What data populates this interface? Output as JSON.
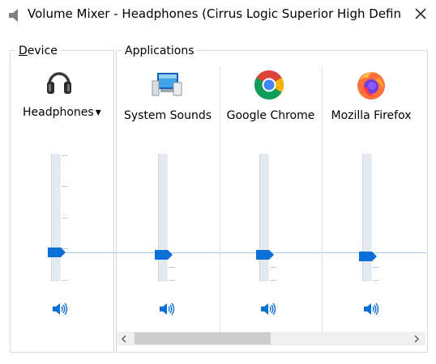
{
  "window": {
    "title": "Volume Mixer - Headphones (Cirrus Logic Superior High Definition ...",
    "close_glyph": "close-icon"
  },
  "device": {
    "group_label_first": "D",
    "group_label_rest": "evice",
    "name": "Headphones",
    "dropdown_glyph": "▾",
    "volume_level": 0.23,
    "icon": "headphones-icon"
  },
  "applications": {
    "group_label": "Applications",
    "items": [
      {
        "label": "System Sounds",
        "icon": "system-sounds-icon",
        "volume_level": 0.22
      },
      {
        "label": "Google Chrome",
        "icon": "chrome-icon",
        "volume_level": 0.22
      },
      {
        "label": "Mozilla Firefox",
        "icon": "firefox-icon",
        "volume_level": 0.2
      }
    ]
  },
  "colors": {
    "accent": "#0a6fd6",
    "track": "#e3e9ee",
    "border": "#d8d8d8",
    "peak_line": "#a8c9e6"
  },
  "scrollbar": {
    "left_arrow": "‹",
    "right_arrow": "›"
  }
}
